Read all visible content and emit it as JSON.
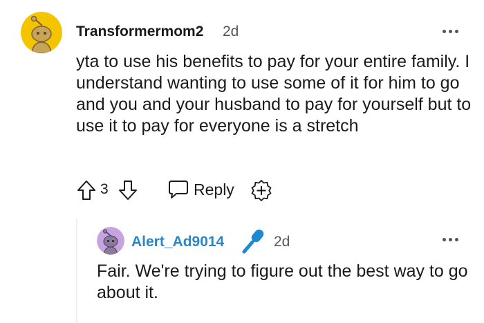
{
  "comment": {
    "username": "Transformermom2",
    "timestamp": "2d",
    "body": "yta to use his benefits to pay for your entire family. I understand wanting to use some of it for him to go and you and your husband to pay for yourself but to use it to pay for everyone is a stretch",
    "vote_count": "3",
    "reply_label": "Reply",
    "avatar_color": "#f5c400",
    "icons": [
      "upvote-arrow-icon",
      "downvote-arrow-icon",
      "speech-bubble-icon",
      "add-award-icon",
      "more-options-icon"
    ]
  },
  "reply": {
    "username": "Alert_Ad9014",
    "timestamp": "2d",
    "body": "Fair. We're trying to figure out the best way to go about it.",
    "username_color": "#2b86c5",
    "avatar_color": "#c6a4e0",
    "badge_icon": "microphone-icon"
  }
}
